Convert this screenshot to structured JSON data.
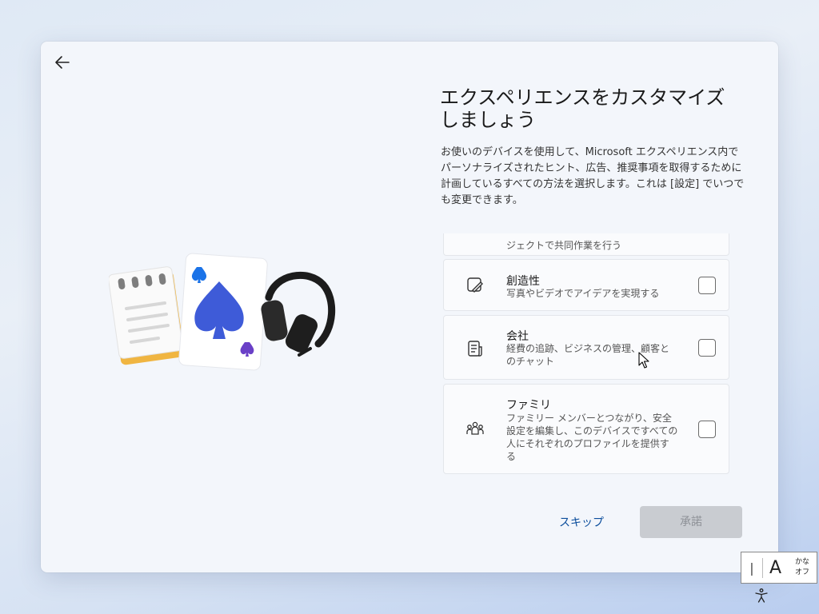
{
  "header": {
    "title": "エクスペリエンスをカスタマイズしましょう",
    "description": "お使いのデバイスを使用して、Microsoft エクスペリエンス内でパーソナライズされたヒント、広告、推奨事項を取得するために計画しているすべての方法を選択します。これは [設定] でいつでも変更できます。"
  },
  "options": [
    {
      "name": "",
      "sub": "ジェクトで共同作業を行う",
      "icon": "collaboration-icon",
      "checked": false
    },
    {
      "name": "創造性",
      "sub": "写真やビデオでアイデアを実現する",
      "icon": "creativity-icon",
      "checked": false
    },
    {
      "name": "会社",
      "sub": "経費の追跡、ビジネスの管理、顧客とのチャット",
      "icon": "business-icon",
      "checked": false
    },
    {
      "name": "ファミリ",
      "sub": "ファミリー メンバーとつながり、安全設定を編集し、このデバイスですべての人にそれぞれのプロファイルを提供する",
      "icon": "family-icon",
      "checked": false
    }
  ],
  "footer": {
    "skip_label": "スキップ",
    "accept_label": "承諾"
  },
  "ime": {
    "mode_char": "A",
    "kana_line1": "かな",
    "kana_line2": "オフ"
  },
  "colors": {
    "accent": "#0c4e9c",
    "disabled_button": "#c9ccd1",
    "spade": "#3e5bd8"
  }
}
